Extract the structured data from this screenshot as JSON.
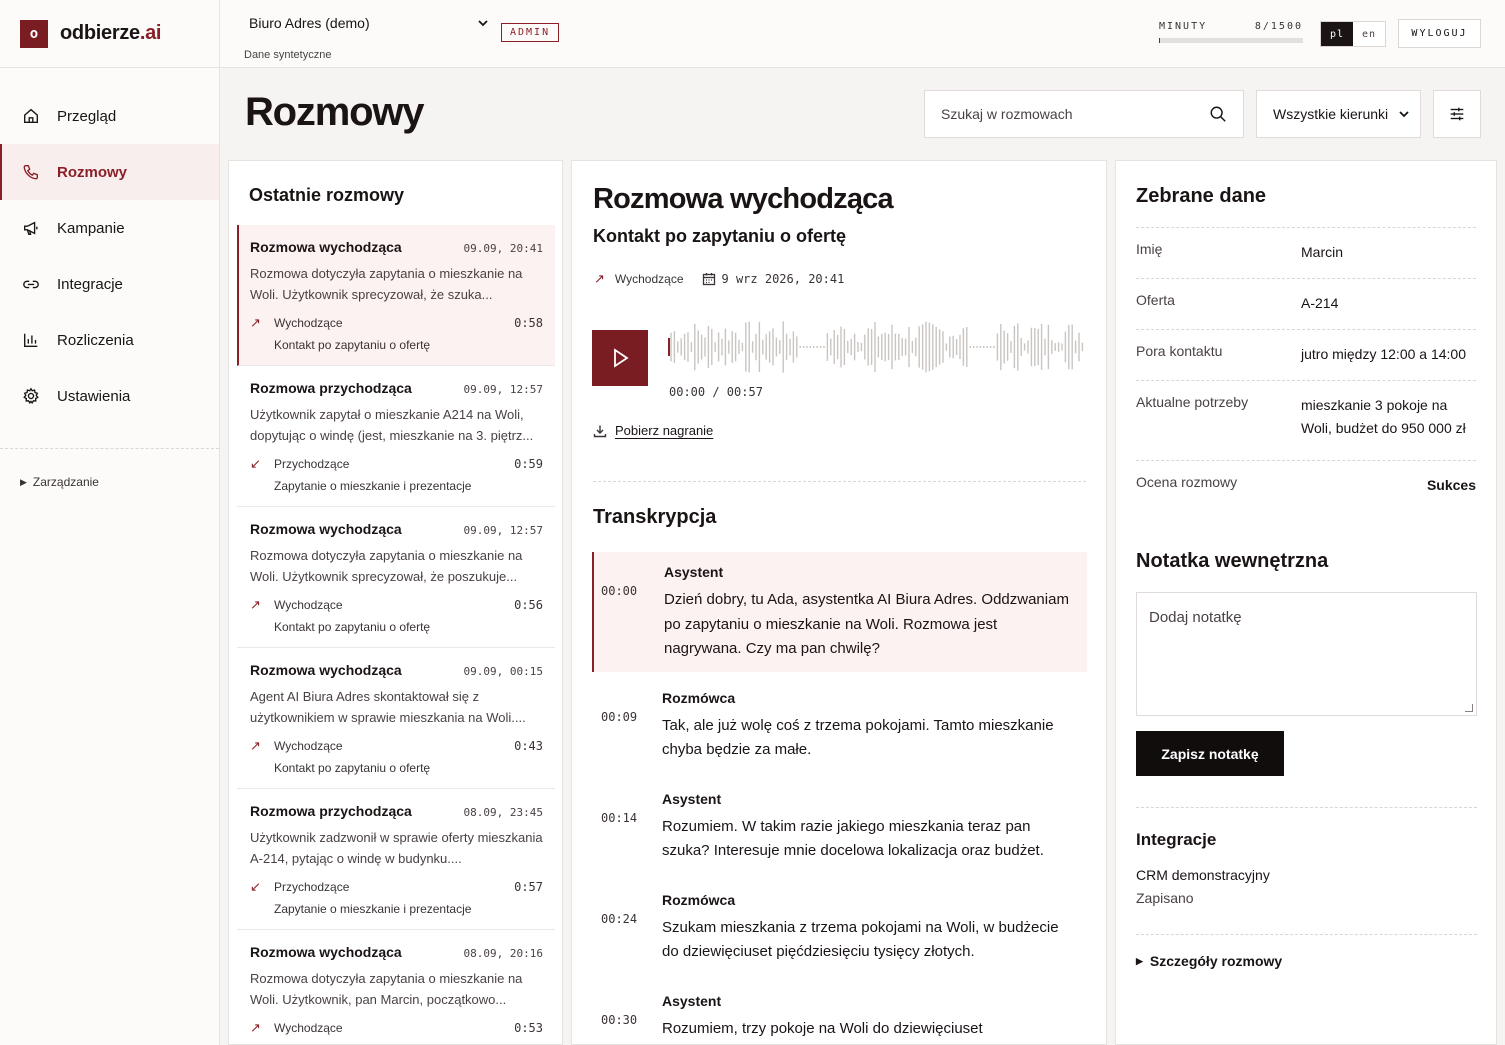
{
  "brand": {
    "mark": "o",
    "name_main": "odbierze",
    "name_accent": ".ai"
  },
  "sidebar": {
    "items": [
      {
        "label": "Przegląd",
        "icon": "home-icon"
      },
      {
        "label": "Rozmowy",
        "icon": "phone-icon",
        "active": true
      },
      {
        "label": "Kampanie",
        "icon": "megaphone-icon"
      },
      {
        "label": "Integracje",
        "icon": "link-icon"
      },
      {
        "label": "Rozliczenia",
        "icon": "bar-chart-icon"
      },
      {
        "label": "Ustawienia",
        "icon": "gear-icon"
      }
    ],
    "management": "Zarządzanie"
  },
  "topbar": {
    "org": "Biuro Adres (demo)",
    "org_sub": "Dane syntetyczne",
    "badge": "ADMIN",
    "minutes_label": "MINUTY",
    "minutes_value": "8/1500",
    "minutes_fraction": 0.0053,
    "lang_active": "pl",
    "lang_other": "en",
    "logout": "WYLOGUJ"
  },
  "page": {
    "title": "Rozmowy",
    "search_placeholder": "Szukaj w rozmowach",
    "direction_filter": "Wszystkie kierunki"
  },
  "list": {
    "title": "Ostatnie rozmowy",
    "calls": [
      {
        "title": "Rozmowa wychodząca",
        "time": "09.09, 20:41",
        "summary": "Rozmowa dotyczyła zapytania o mieszkanie na Woli. Użytkownik sprecyzował, że szuka...",
        "direction": "Wychodzące",
        "arrow": "↗",
        "duration": "0:58",
        "campaign": "Kontakt po zapytaniu o ofertę"
      },
      {
        "title": "Rozmowa przychodząca",
        "time": "09.09, 12:57",
        "summary": "Użytkownik zapytał o mieszkanie A214 na Woli, dopytując o windę (jest, mieszkanie na 3. piętrz...",
        "direction": "Przychodzące",
        "arrow": "↙",
        "duration": "0:59",
        "campaign": "Zapytanie o mieszkanie i prezentacje"
      },
      {
        "title": "Rozmowa wychodząca",
        "time": "09.09, 12:57",
        "summary": "Rozmowa dotyczyła zapytania o mieszkanie na Woli. Użytkownik sprecyzował, że poszukuje...",
        "direction": "Wychodzące",
        "arrow": "↗",
        "duration": "0:56",
        "campaign": "Kontakt po zapytaniu o ofertę"
      },
      {
        "title": "Rozmowa wychodząca",
        "time": "09.09, 00:15",
        "summary": "Agent AI Biura Adres skontaktował się z użytkownikiem w sprawie mieszkania na Woli....",
        "direction": "Wychodzące",
        "arrow": "↗",
        "duration": "0:43",
        "campaign": "Kontakt po zapytaniu o ofertę"
      },
      {
        "title": "Rozmowa przychodząca",
        "time": "08.09, 23:45",
        "summary": "Użytkownik zadzwonił w sprawie oferty mieszkania A-214, pytając o windę w budynku....",
        "direction": "Przychodzące",
        "arrow": "↙",
        "duration": "0:57",
        "campaign": "Zapytanie o mieszkanie i prezentacje"
      },
      {
        "title": "Rozmowa wychodząca",
        "time": "08.09, 20:16",
        "summary": "Rozmowa dotyczyła zapytania o mieszkanie na Woli. Użytkownik, pan Marcin, początkowo...",
        "direction": "Wychodzące",
        "arrow": "↗",
        "duration": "0:53",
        "campaign": ""
      }
    ]
  },
  "detail": {
    "title": "Rozmowa wychodząca",
    "subtitle": "Kontakt po zapytaniu o ofertę",
    "direction": "Wychodzące",
    "date": "9 wrz 2026, 20:41",
    "timecode": "00:00 / 00:57",
    "download": "Pobierz nagranie",
    "transcript_title": "Transkrypcja",
    "transcript": [
      {
        "time": "00:00",
        "speaker": "Asystent",
        "text": "Dzień dobry, tu Ada, asystentka AI Biura Adres. Oddzwaniam po zapytaniu o mieszkanie na Woli. Rozmowa jest nagrywana. Czy ma pan chwilę?",
        "active": true
      },
      {
        "time": "00:09",
        "speaker": "Rozmówca",
        "text": "Tak, ale już wolę coś z trzema pokojami. Tamto mieszkanie chyba będzie za małe."
      },
      {
        "time": "00:14",
        "speaker": "Asystent",
        "text": "Rozumiem. W takim razie jakiego mieszkania teraz pan szuka? Interesuje mnie docelowa lokalizacja oraz budżet."
      },
      {
        "time": "00:24",
        "speaker": "Rozmówca",
        "text": "Szukam mieszkania z trzema pokojami na Woli, w budżecie do dziewięciuset pięćdziesięciu tysięcy złotych."
      },
      {
        "time": "00:30",
        "speaker": "Asystent",
        "text": "Rozumiem, trzy pokoje na Woli do dziewięciuset"
      }
    ]
  },
  "data_panel": {
    "title": "Zebrane dane",
    "fields": [
      {
        "label": "Imię",
        "value": "Marcin"
      },
      {
        "label": "Oferta",
        "value": "A-214"
      },
      {
        "label": "Pora kontaktu",
        "value": "jutro między 12:00 a 14:00"
      },
      {
        "label": "Aktualne potrzeby",
        "value": "mieszkanie 3 pokoje na Woli, budżet do 950 000 zł"
      },
      {
        "label": "Ocena rozmowy",
        "value": "Sukces"
      }
    ],
    "note_title": "Notatka wewnętrzna",
    "note_placeholder": "Dodaj notatkę",
    "save_button": "Zapisz notatkę",
    "integrations_title": "Integracje",
    "integration_name": "CRM demonstracyjny",
    "integration_status": "Zapisano",
    "details_toggle": "Szczegóły rozmowy"
  },
  "colors": {
    "accent": "#8a1f27",
    "accent_bg": "#fcf2f2",
    "dark": "#120d0d"
  }
}
